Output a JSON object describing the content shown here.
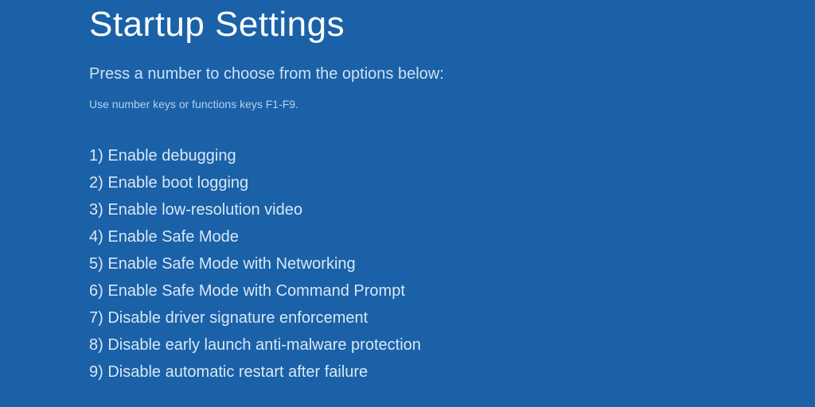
{
  "title": "Startup Settings",
  "instruction": "Press a number to choose from the options below:",
  "hint": "Use number keys or functions keys F1-F9.",
  "options": [
    {
      "num": "1)",
      "label": "Enable debugging"
    },
    {
      "num": "2)",
      "label": "Enable boot logging"
    },
    {
      "num": "3)",
      "label": "Enable low-resolution video"
    },
    {
      "num": "4)",
      "label": "Enable Safe Mode"
    },
    {
      "num": "5)",
      "label": "Enable Safe Mode with Networking"
    },
    {
      "num": "6)",
      "label": "Enable Safe Mode with Command Prompt"
    },
    {
      "num": "7)",
      "label": "Disable driver signature enforcement"
    },
    {
      "num": "8)",
      "label": "Disable early launch anti-malware protection"
    },
    {
      "num": "9)",
      "label": "Disable automatic restart after failure"
    }
  ]
}
